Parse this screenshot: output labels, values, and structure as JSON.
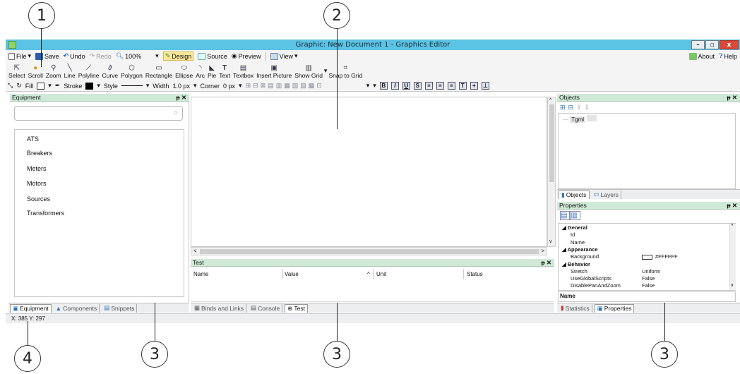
{
  "window": {
    "title": "Graphic: New Document 1 - Graphics Editor"
  },
  "menu": {
    "file": "File",
    "save": "Save",
    "undo": "Undo",
    "redo": "Redo",
    "zoom": "100%",
    "design": "Design",
    "source": "Source",
    "preview": "Preview",
    "view": "View",
    "about": "About",
    "help": "Help"
  },
  "tools": [
    {
      "label": "Select",
      "icon": "select-icon"
    },
    {
      "label": "Scroll",
      "icon": "scroll-icon"
    },
    {
      "label": "Zoom",
      "icon": "zoom-icon"
    },
    {
      "label": "Line",
      "icon": "line-icon"
    },
    {
      "label": "Polyline",
      "icon": "polyline-icon"
    },
    {
      "label": "Curve",
      "icon": "curve-icon"
    },
    {
      "label": "Polygon",
      "icon": "polygon-icon"
    },
    {
      "label": "Rectangle",
      "icon": "rectangle-icon"
    },
    {
      "label": "Ellipse",
      "icon": "ellipse-icon"
    },
    {
      "label": "Arc",
      "icon": "arc-icon"
    },
    {
      "label": "Pie",
      "icon": "pie-icon"
    },
    {
      "label": "Text",
      "icon": "text-icon"
    },
    {
      "label": "Textbox",
      "icon": "textbox-icon"
    },
    {
      "label": "Insert Picture",
      "icon": "picture-icon"
    },
    {
      "label": "Show Grid",
      "icon": "grid-icon"
    },
    {
      "label": "Snap to Grid",
      "icon": "snap-icon"
    }
  ],
  "format": {
    "fill": "Fill",
    "stroke": "Stroke",
    "style": "Style",
    "width_label": "Width",
    "width_value": "1.0 px",
    "corner_label": "Corner",
    "corner_value": "0 px"
  },
  "equipment": {
    "title": "Equipment",
    "items": [
      "ATS",
      "Breakers",
      "Meters",
      "Motors",
      "Sources",
      "Transformers"
    ]
  },
  "left_tabs": [
    "Equipment",
    "Components",
    "Snippets"
  ],
  "test_panel": {
    "title": "Test",
    "columns": [
      "Name",
      "Value",
      "Unit",
      "Status"
    ]
  },
  "center_tabs": [
    "Binds and Links",
    "Console",
    "Test"
  ],
  "objects_panel": {
    "title": "Objects",
    "root": "Tgml",
    "tabs": [
      "Objects",
      "Layers"
    ]
  },
  "properties_panel": {
    "title": "Properties",
    "rows": [
      {
        "name": "General",
        "value": "",
        "group": true
      },
      {
        "name": "Id",
        "value": "",
        "group": false
      },
      {
        "name": "Name",
        "value": "",
        "group": false
      },
      {
        "name": "Appearance",
        "value": "",
        "group": true
      },
      {
        "name": "Background",
        "value": "#FFFFFF",
        "group": false
      },
      {
        "name": "Behavior",
        "value": "",
        "group": true
      },
      {
        "name": "Stretch",
        "value": "Uniform",
        "group": false
      },
      {
        "name": "UseGlobalScripts",
        "value": "False",
        "group": false
      },
      {
        "name": "DisablePanAndZoom",
        "value": "False",
        "group": false
      }
    ],
    "description_title": "Name",
    "tabs": [
      "Statistics",
      "Properties"
    ]
  },
  "status": {
    "coords": "X: 385 Y: 297"
  },
  "callouts": [
    "1",
    "2",
    "3",
    "4"
  ],
  "colors": {
    "titlebar": "#5bc3e4",
    "panel_header": "#cfe9d6",
    "accent": "#2a6fb8"
  }
}
